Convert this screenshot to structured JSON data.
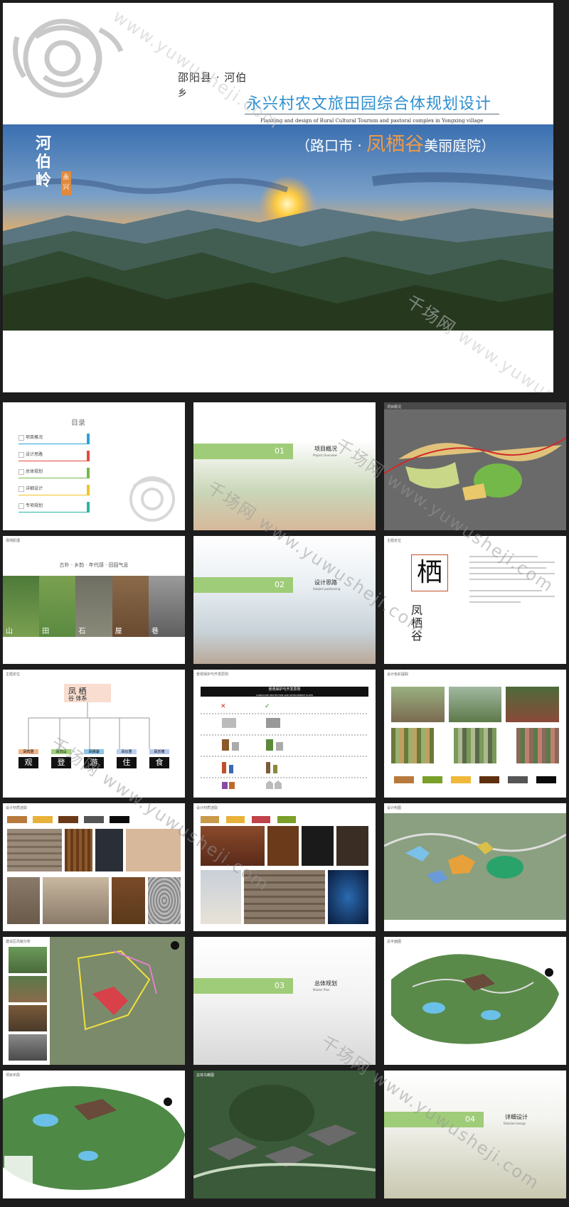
{
  "cover": {
    "county": "邵阳县 · 河伯",
    "county_tail": "乡",
    "title": "永兴村农文旅田园综合体规划设计",
    "subtitle": "Planning and design of Rural Cultural Tourism and pastoral complex in Yongxing village",
    "caption_pre": "（路口市 · ",
    "caption_hl": "凤栖谷",
    "caption_post": "美丽庭院）",
    "calligraphy": "河伯岭",
    "seal": "永兴"
  },
  "watermarks": [
    "www.yuwusheji.com",
    "千场网 www.yuwusheji.com"
  ],
  "toc": {
    "title": "目录",
    "items": [
      {
        "label": "项目概况",
        "color": "#2aa3d8"
      },
      {
        "label": "设计思路",
        "color": "#e8493f"
      },
      {
        "label": "总体规划",
        "color": "#74b84a"
      },
      {
        "label": "详细设计",
        "color": "#f2c22a"
      },
      {
        "label": "专项规划",
        "color": "#2bb5a8"
      }
    ]
  },
  "sections": [
    {
      "num": "01",
      "title": "项目概况",
      "en": "Project Overview"
    },
    {
      "num": "02",
      "title": "设计思路",
      "en": "Subject positioning"
    },
    {
      "num": "03",
      "title": "总体规划",
      "en": "Master Plan"
    },
    {
      "num": "04",
      "title": "详细设计",
      "en": "Detailed design"
    }
  ],
  "slide_tags": {
    "overview": "项目概况",
    "context": "场地肌理",
    "theme": "主题定位",
    "system": "主题定位",
    "rules": "景观保护与开发原则",
    "palette": "设计色彩提取",
    "materials": "设计材质选取",
    "materials2": "设计材质选取",
    "layout": "设计构图",
    "analysis": "建设区风貌分析",
    "plan": "总平面图",
    "plan2": "项目布局",
    "aerial": "总体鸟瞰图"
  },
  "context_slide": {
    "heading": "古朴 · 乡韵 · 年代感 · 田园气息",
    "labels": [
      "山",
      "田",
      "石",
      "屋",
      "巷"
    ]
  },
  "theme_slide": {
    "big": "栖",
    "vertical": "凤栖谷"
  },
  "system_slide": {
    "title_line1": "凤 栖",
    "title_line2": "谷 体系",
    "branches": [
      {
        "tag": "凤鸣居",
        "char": "观",
        "color": "#f0b48a"
      },
      {
        "tag": "凤归山",
        "char": "登",
        "color": "#9fd07a"
      },
      {
        "tag": "凤栖湖",
        "char": "游",
        "color": "#8ec5e8"
      },
      {
        "tag": "凤仪居",
        "char": "住",
        "color": "#b9d0f0"
      },
      {
        "tag": "凤乐楼",
        "char": "食",
        "color": "#b5c8f0"
      }
    ]
  },
  "rules_slide": {
    "header": "景观保护与开发原则",
    "sub": "LANDSCAPE PROTECTION AND DEVELOPMENT RULES"
  },
  "palette_colors": [
    "#b87a3c",
    "#7aa02a",
    "#f0b83a",
    "#5e3010",
    "#555555",
    "#0a0a0a"
  ],
  "material_colors": [
    "#b87a3c",
    "#e8b23a",
    "#6a3a18",
    "#555555",
    "#0a0a0a"
  ],
  "material_colors2": [
    "#c99a4a",
    "#e8b23a",
    "#c0434a",
    "#7aa02a"
  ]
}
